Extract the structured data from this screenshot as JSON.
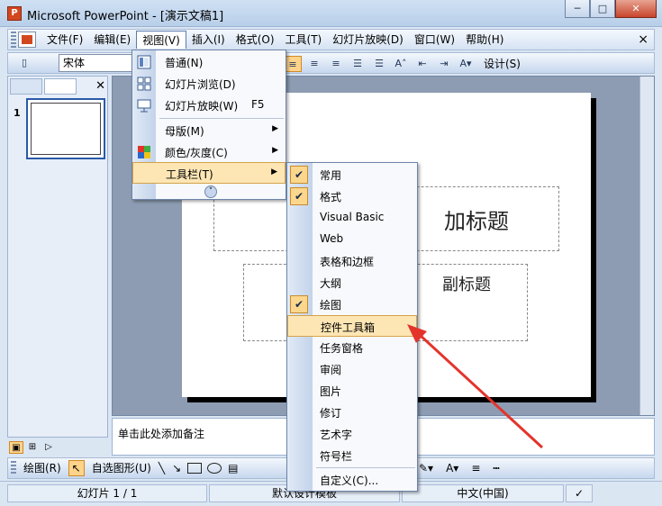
{
  "window": {
    "title": "Microsoft PowerPoint - [演示文稿1]"
  },
  "menubar": {
    "items": [
      {
        "label": "文件(F)"
      },
      {
        "label": "编辑(E)"
      },
      {
        "label": "视图(V)"
      },
      {
        "label": "插入(I)"
      },
      {
        "label": "格式(O)"
      },
      {
        "label": "工具(T)"
      },
      {
        "label": "幻灯片放映(D)"
      },
      {
        "label": "窗口(W)"
      },
      {
        "label": "帮助(H)"
      }
    ],
    "close": "×"
  },
  "toolbar": {
    "font": "宋体",
    "design_label": "设计(S)"
  },
  "view_menu": {
    "items": [
      {
        "label": "普通(N)",
        "shortcut": ""
      },
      {
        "label": "幻灯片浏览(D)",
        "shortcut": ""
      },
      {
        "label": "幻灯片放映(W)",
        "shortcut": "F5"
      },
      {
        "label": "母版(M)",
        "shortcut": ""
      },
      {
        "label": "颜色/灰度(C)",
        "shortcut": ""
      },
      {
        "label": "工具栏(T)",
        "shortcut": ""
      }
    ]
  },
  "toolbars_submenu": {
    "items": [
      {
        "label": "常用",
        "checked": true
      },
      {
        "label": "格式",
        "checked": true
      },
      {
        "label": "Visual Basic",
        "checked": false
      },
      {
        "label": "Web",
        "checked": false
      },
      {
        "label": "表格和边框",
        "checked": false
      },
      {
        "label": "大纲",
        "checked": false
      },
      {
        "label": "绘图",
        "checked": true
      },
      {
        "label": "控件工具箱",
        "checked": false
      },
      {
        "label": "任务窗格",
        "checked": false
      },
      {
        "label": "审阅",
        "checked": false
      },
      {
        "label": "图片",
        "checked": false
      },
      {
        "label": "修订",
        "checked": false
      },
      {
        "label": "艺术字",
        "checked": false
      },
      {
        "label": "符号栏",
        "checked": false
      },
      {
        "label": "自定义(C)...",
        "checked": false
      }
    ]
  },
  "left_pane": {
    "slide_number": "1"
  },
  "slide": {
    "title_placeholder": "加标题",
    "subtitle_placeholder": "副标题"
  },
  "notes": {
    "placeholder": "单击此处添加备注"
  },
  "drawbar": {
    "draw_label": "绘图(R)",
    "autoshape_label": "自选图形(U)"
  },
  "status": {
    "slide": "幻灯片 1 / 1",
    "design": "默认设计模板",
    "language": "中文(中国)"
  },
  "colors": {
    "highlight": "#fde6b4",
    "arrow": "#e3342c",
    "chrome": "#dbe6f3"
  }
}
